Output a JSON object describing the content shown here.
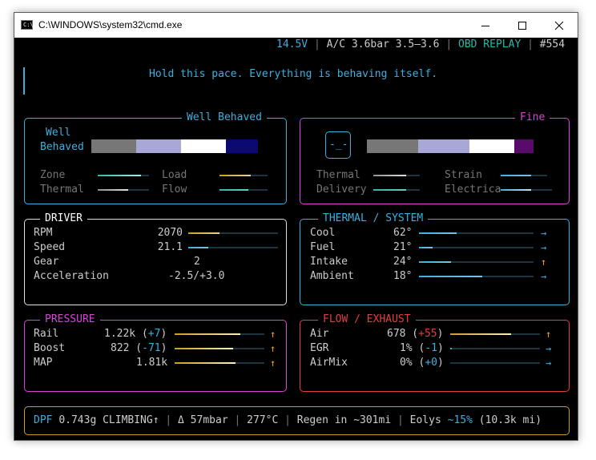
{
  "window": {
    "title": "C:\\WINDOWS\\system32\\cmd.exe",
    "icon_label": "C:\\",
    "icon": "console-icon"
  },
  "controls": {
    "minimize": "minimize-icon",
    "maximize": "maximize-icon",
    "close": "close-icon"
  },
  "status": {
    "voltage": "14.5V",
    "ac": "A/C 3.6bar 3.5–3.6",
    "mode": "OBD REPLAY",
    "frame": "#554",
    "separator": " | "
  },
  "message": "Hold this pace. Everything is behaving itself.",
  "left_panel": {
    "title": "Well Behaved",
    "label_line1": "Well",
    "label_line2": "Behaved",
    "metrics": [
      "Zone",
      "Load",
      "Thermal",
      "Flow"
    ],
    "levels": [
      0.85,
      0.65,
      0.6,
      0.6
    ]
  },
  "right_panel": {
    "title": "Fine",
    "face": "-_-",
    "metrics": [
      "Thermal",
      "Strain",
      "Delivery",
      "Electrica"
    ],
    "levels": [
      0.7,
      0.65,
      0.7,
      0.6
    ]
  },
  "driver": {
    "title": "DRIVER",
    "rows": [
      {
        "label": "RPM",
        "value": "2070",
        "level": 0.35
      },
      {
        "label": "Speed",
        "value": "21.1",
        "level": 0.22
      },
      {
        "label": "Gear",
        "value": "2"
      },
      {
        "label": "Acceleration",
        "value": "-2.5/+3.0"
      }
    ]
  },
  "thermal": {
    "title": "THERMAL / SYSTEM",
    "rows": [
      {
        "label": "Cool",
        "value": "62°",
        "level": 0.33,
        "arrow": "→"
      },
      {
        "label": "Fuel",
        "value": "21°",
        "level": 0.12,
        "arrow": "→"
      },
      {
        "label": "Intake",
        "value": "24°",
        "level": 0.28,
        "arrow": "↑"
      },
      {
        "label": "Ambient",
        "value": "18°",
        "level": 0.55,
        "arrow": "→"
      }
    ]
  },
  "pressure": {
    "title": "PRESSURE",
    "rows": [
      {
        "label": "Rail",
        "value": "1.22k",
        "delta": "+7",
        "level": 0.73,
        "arrow": "↑"
      },
      {
        "label": "Boost",
        "value": "822",
        "delta": "-71",
        "level": 0.65,
        "arrow": "↑"
      },
      {
        "label": "MAP",
        "value": "1.81k",
        "delta": "",
        "level": 0.68,
        "arrow": "↑"
      }
    ]
  },
  "flow": {
    "title": "FLOW / EXHAUST",
    "rows": [
      {
        "label": "Air",
        "value": "678",
        "delta": "+55",
        "level": 0.68,
        "arrow": "↑"
      },
      {
        "label": "EGR",
        "value": "1%",
        "delta": "-1",
        "level": 0.02,
        "arrow": "→"
      },
      {
        "label": "AirMix",
        "value": "0%",
        "delta": "+0",
        "level": 0.0,
        "arrow": "→"
      }
    ]
  },
  "footer": {
    "dpf_label": "DPF",
    "dpf": "0.743g CLIMBING↑",
    "delta": "Δ 57mbar",
    "temp": "277°C",
    "regen": "Regen in ~301mi",
    "eolys_label": "Eolys",
    "eolys_pct": "~15%",
    "eolys_rest": "(10.3k mi)"
  },
  "colors": {
    "cyan": "#3ab0e0",
    "teal": "#2fb8a8",
    "green": "#16c60c",
    "magenta": "#d844d8",
    "red": "#e04040",
    "orange": "#f0a030",
    "yellow": "#c8a020",
    "text": "#cccccc",
    "dim": "#767676"
  }
}
